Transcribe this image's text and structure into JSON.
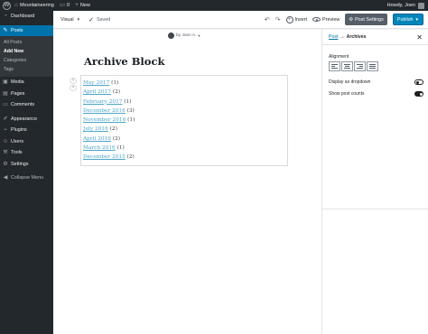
{
  "admin_bar": {
    "site_name": "Mountaineering",
    "comments_count": "0",
    "new_label": "New",
    "greeting": "Howdy, Joen"
  },
  "sidebar": {
    "items": [
      {
        "label": "Dashboard",
        "icon": "dashboard-icon"
      },
      {
        "label": "Posts",
        "icon": "pin-icon",
        "current": true
      },
      {
        "label": "Media",
        "icon": "media-icon"
      },
      {
        "label": "Pages",
        "icon": "pages-icon"
      },
      {
        "label": "Comments",
        "icon": "comments-icon"
      },
      {
        "label": "Appearance",
        "icon": "brush-icon"
      },
      {
        "label": "Plugins",
        "icon": "plugin-icon"
      },
      {
        "label": "Users",
        "icon": "users-icon"
      },
      {
        "label": "Tools",
        "icon": "wrench-icon"
      },
      {
        "label": "Settings",
        "icon": "settings-icon"
      },
      {
        "label": "Collapse Menu",
        "icon": "collapse-icon"
      }
    ],
    "posts_submenu": [
      "All Posts",
      "Add New",
      "Categories",
      "Tags"
    ]
  },
  "toolbar": {
    "mode": "Visual",
    "saved": "Saved",
    "insert": "Insert",
    "preview": "Preview",
    "post_settings": "Post Settings",
    "publish": "Publish"
  },
  "post": {
    "author": "by Joen A.",
    "title": "Archive Block",
    "archives": [
      {
        "month": "May 2017",
        "count": "(1)"
      },
      {
        "month": "April 2017",
        "count": "(2)"
      },
      {
        "month": "February 2017",
        "count": "(1)"
      },
      {
        "month": "December 2016",
        "count": "(3)"
      },
      {
        "month": "November 2016",
        "count": "(1)"
      },
      {
        "month": "July 2016",
        "count": "(2)"
      },
      {
        "month": "April 2016",
        "count": "(2)"
      },
      {
        "month": "March 2016",
        "count": "(1)"
      },
      {
        "month": "December 2015",
        "count": "(2)"
      }
    ]
  },
  "settings_panel": {
    "breadcrumb_parent": "Post",
    "arrow": "→",
    "current": "Archives",
    "alignment_label": "Alignment",
    "dropdown_label": "Display as dropdown",
    "dropdown_on": false,
    "post_counts_label": "Show post counts",
    "post_counts_on": true
  },
  "colors": {
    "admin_dark": "#23282d",
    "accent": "#0073aa",
    "publish": "#0085ba",
    "link": "#4aa3c9"
  }
}
